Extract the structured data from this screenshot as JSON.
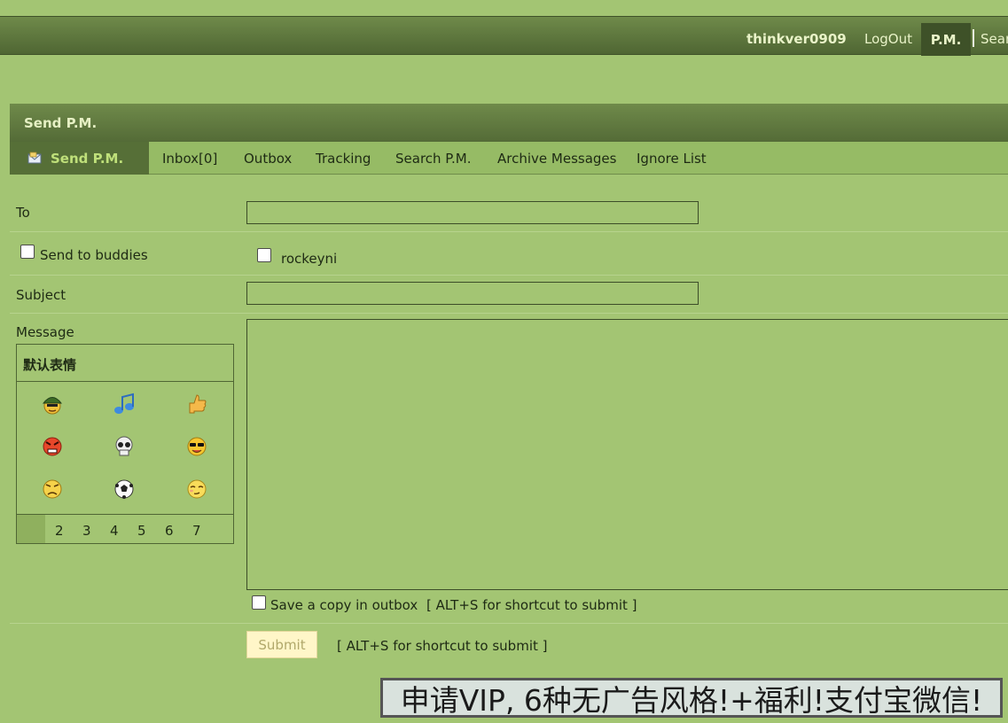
{
  "topbar": {
    "username": "thinkver0909",
    "logout": "LogOut",
    "pm": "P.M.",
    "search": "Sear"
  },
  "header": {
    "title": "Send P.M."
  },
  "tabs": {
    "active": "Send P.M.",
    "items": [
      "Inbox[0]",
      "Outbox",
      "Tracking",
      "Search P.M.",
      "Archive Messages",
      "Ignore List"
    ]
  },
  "form": {
    "to_label": "To",
    "to_value": "",
    "buddies_label": "Send to buddies",
    "buddy_name": "rockeyni",
    "subject_label": "Subject",
    "subject_value": "",
    "message_label": "Message",
    "message_value": "",
    "save_copy_label": "Save a copy in outbox",
    "shortcut_hint": "[ ALT+S for shortcut to submit ]",
    "submit_label": "Submit",
    "submit_hint": "[ ALT+S for shortcut to submit ]"
  },
  "smilies": {
    "title": "默认表情",
    "pages": [
      "2",
      "3",
      "4",
      "5",
      "6",
      "7"
    ],
    "icons": [
      "soldier-smiley-icon",
      "music-note-icon",
      "thumbs-up-icon",
      "angry-smiley-icon",
      "skull-icon",
      "cool-smiley-icon",
      "grumpy-smiley-icon",
      "soccer-ball-icon",
      "shy-smiley-icon"
    ]
  },
  "ad": {
    "text": "申请VIP, 6种无广告风格!+福利!支付宝微信!"
  },
  "colors": {
    "background": "#a3c573",
    "bar": "#566f37",
    "accent_text": "#bfe07a"
  }
}
